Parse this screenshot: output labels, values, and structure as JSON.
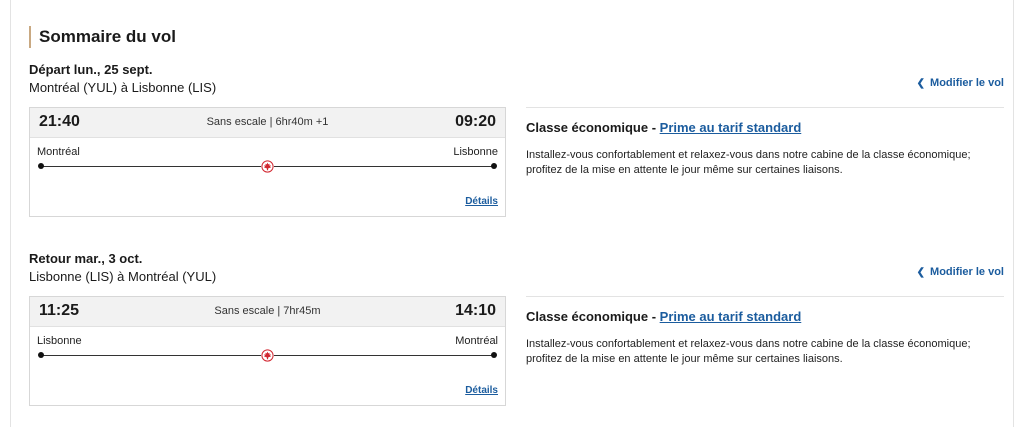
{
  "summary": {
    "title": "Sommaire du vol"
  },
  "segments": [
    {
      "label": "Départ lun., 25 sept.",
      "route": "Montréal (YUL) à Lisbonne (LIS)",
      "modify_label": "Modifier le vol",
      "departure_time": "21:40",
      "arrival_time": "09:20",
      "stop_info": "Sans escale | 6hr40m +1",
      "departure_city": "Montréal",
      "arrival_city": "Lisbonne",
      "details_label": "Détails",
      "cabin_class": "Classe économique - ",
      "fare_type": "Prime au tarif standard",
      "cabin_description": "Installez-vous confortablement et relaxez-vous dans notre cabine de la classe économique; profitez de la mise en attente le jour même sur certaines liaisons."
    },
    {
      "label": "Retour mar., 3 oct.",
      "route": "Lisbonne (LIS) à Montréal (YUL)",
      "modify_label": "Modifier le vol",
      "departure_time": "11:25",
      "arrival_time": "14:10",
      "stop_info": "Sans escale | 7hr45m",
      "departure_city": "Lisbonne",
      "arrival_city": "Montréal",
      "details_label": "Détails",
      "cabin_class": "Classe économique - ",
      "fare_type": "Prime au tarif standard",
      "cabin_description": "Installez-vous confortablement et relaxez-vous dans notre cabine de la classe économique; profitez de la mise en attente le jour même sur certaines liaisons."
    }
  ],
  "icons": {
    "chevron": "chevron-left-icon",
    "maple_leaf": "maple-leaf-icon"
  },
  "colors": {
    "link": "#1b5c9e",
    "maple_leaf": "#d22630",
    "title_accent": "#c9a982"
  }
}
